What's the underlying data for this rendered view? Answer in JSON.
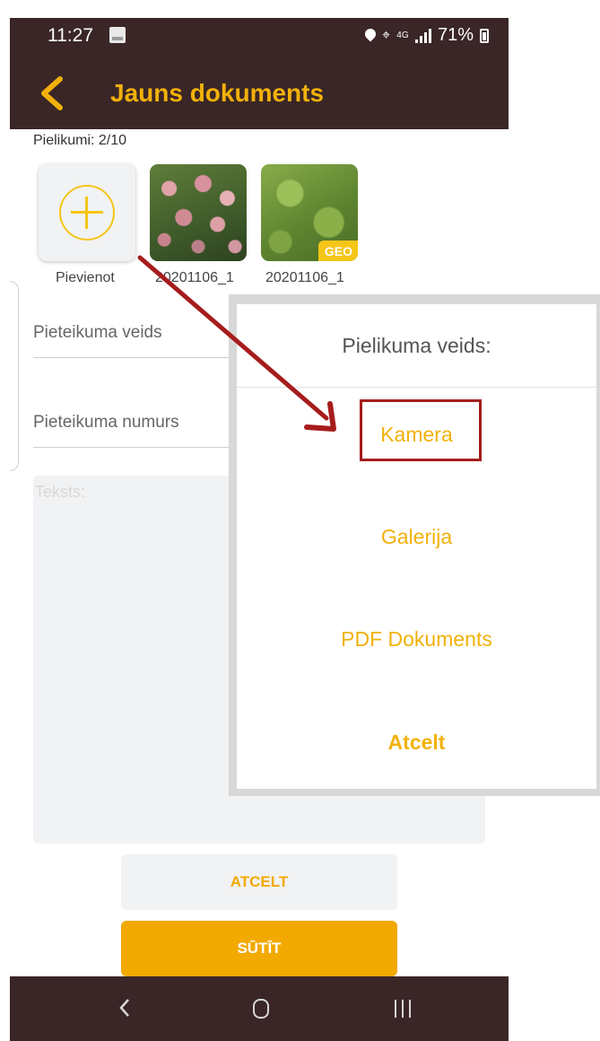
{
  "status_bar": {
    "time": "11:27",
    "network": "4G",
    "battery": "71%"
  },
  "app_bar": {
    "title": "Jauns dokuments"
  },
  "attachments": {
    "count_label": "Pielikumi: 2/10",
    "add_label": "Pievienot",
    "items": [
      {
        "label": "20201106_1",
        "geo": false
      },
      {
        "label": "20201106_1",
        "geo": true,
        "badge": "GEO"
      }
    ]
  },
  "form": {
    "type_placeholder": "Pieteikuma veids",
    "number_placeholder": "Pieteikuma numurs",
    "text_placeholder": "Teksts:"
  },
  "buttons": {
    "cancel": "ATCELT",
    "send": "SŪTĪT"
  },
  "dialog": {
    "title": "Pielikuma veids:",
    "options": [
      "Kamera",
      "Galerija",
      "PDF Dokuments"
    ],
    "cancel": "Atcelt"
  },
  "colors": {
    "accent": "#f2b10a",
    "bar": "#3a2627",
    "annotation": "#a61c1c"
  }
}
